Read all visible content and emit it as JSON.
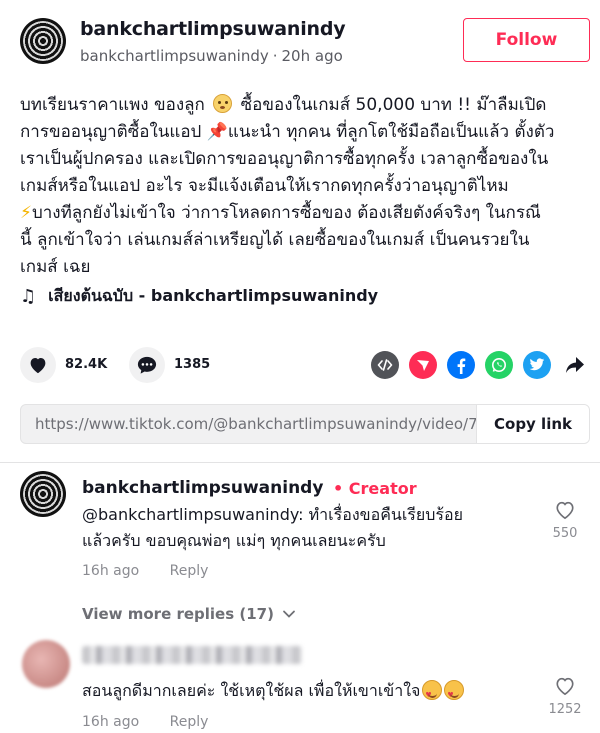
{
  "post": {
    "author_name": "bankchartlimpsuwanindy",
    "author_handle": "bankchartlimpsuwanindy",
    "time": "20h ago",
    "follow_label": "Follow",
    "caption_lines": [
      "บทเรียนราคาแพง ของลูก",
      "ซื้อของในเกมส์ 50,000 บาท !! ม๊าลืมเปิด",
      "การขออนุญาติซื้อในแอป",
      "แนะนำ ทุกคน ที่ลูกโตใช้มือถือเป็นแล้ว ตั้งตัว",
      "เราเป็นผู้ปกครอง และเปิดการขออนุญาติการซื้อทุกครั้ง เวลาลูกซื้อของใน",
      "เกมส์หรือในแอป อะไร จะมีแจ้งเตือนให้เรากดทุกครั้งว่าอนุญาติไหม",
      "บางทีลูกยังไม่เข้าใจ ว่าการโหลดการซื้อของ ต้องเสียตังค์จริงๆ ในกรณี",
      "นี้ ลูกเข้าใจว่า เล่นเกมส์ล่าเหรียญได้ เลยซื้อของในเกมส์ เป็นคนรวยใน",
      "เกมส์ เฉย"
    ],
    "sound": "เสียงต้นฉบับ - bankchartlimpsuwanindy",
    "likes": "82.4K",
    "comments": "1385",
    "link_url": "https://www.tiktok.com/@bankchartlimpsuwanindy/video/71...",
    "copy_link_label": "Copy link"
  },
  "comments": [
    {
      "name": "bankchartlimpsuwanindy",
      "badge": "Creator",
      "text_line1": "@bankchartlimpsuwanindy:  ทำเรื่องขอคืนเรียบร้อย",
      "text_line2": "แล้วครับ ขอบคุณพ่อๆ แม่ๆ ทุกคนเลยนะครับ",
      "time": "16h ago",
      "reply_label": "Reply",
      "likes": "550"
    },
    {
      "text": "สอนลูกดีมากเลยค่ะ ใช้เหตุใช้ผล เพื่อให้เขาเข้าใจ",
      "time": "16h ago",
      "reply_label": "Reply",
      "likes": "1252"
    }
  ],
  "view_more": "View more replies (17)",
  "colors": {
    "accent": "#fe2c55",
    "facebook": "#0075fa",
    "whatsapp": "#25d366",
    "twitter": "#1da1f2",
    "embed": "#515358"
  },
  "icons": [
    "music-note-icon",
    "heart-icon",
    "comment-icon",
    "embed-icon",
    "send-icon",
    "facebook-icon",
    "whatsapp-icon",
    "twitter-icon",
    "share-arrow-icon",
    "chevron-down-icon"
  ]
}
